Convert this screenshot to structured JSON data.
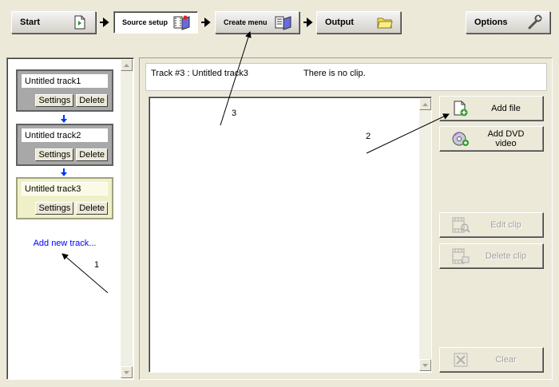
{
  "toolbar": {
    "steps": [
      {
        "label": "Start",
        "icon": "document-arrow-icon"
      },
      {
        "label": "Source setup",
        "icon": "film-box-icon"
      },
      {
        "label": "Create menu",
        "icon": "film-box-icon"
      },
      {
        "label": "Output",
        "icon": "folder-icon"
      }
    ],
    "options_label": "Options",
    "options_icon": "wrench-icon"
  },
  "tracks": {
    "items": [
      {
        "name": "Untitled track1",
        "settings_label": "Settings",
        "delete_label": "Delete",
        "selected": false
      },
      {
        "name": "Untitled track2",
        "settings_label": "Settings",
        "delete_label": "Delete",
        "selected": false
      },
      {
        "name": "Untitled track3",
        "settings_label": "Settings",
        "delete_label": "Delete",
        "selected": true
      }
    ],
    "add_label": "Add new track..."
  },
  "track_header": {
    "title": "Track #3 : Untitled track3",
    "status": "There is no clip."
  },
  "actions": {
    "add_file": "Add file",
    "add_dvd": "Add DVD video",
    "edit_clip": "Edit clip",
    "delete_clip": "Delete clip",
    "clear": "Clear"
  },
  "annotations": {
    "one": "1",
    "two": "2",
    "three": "3"
  }
}
